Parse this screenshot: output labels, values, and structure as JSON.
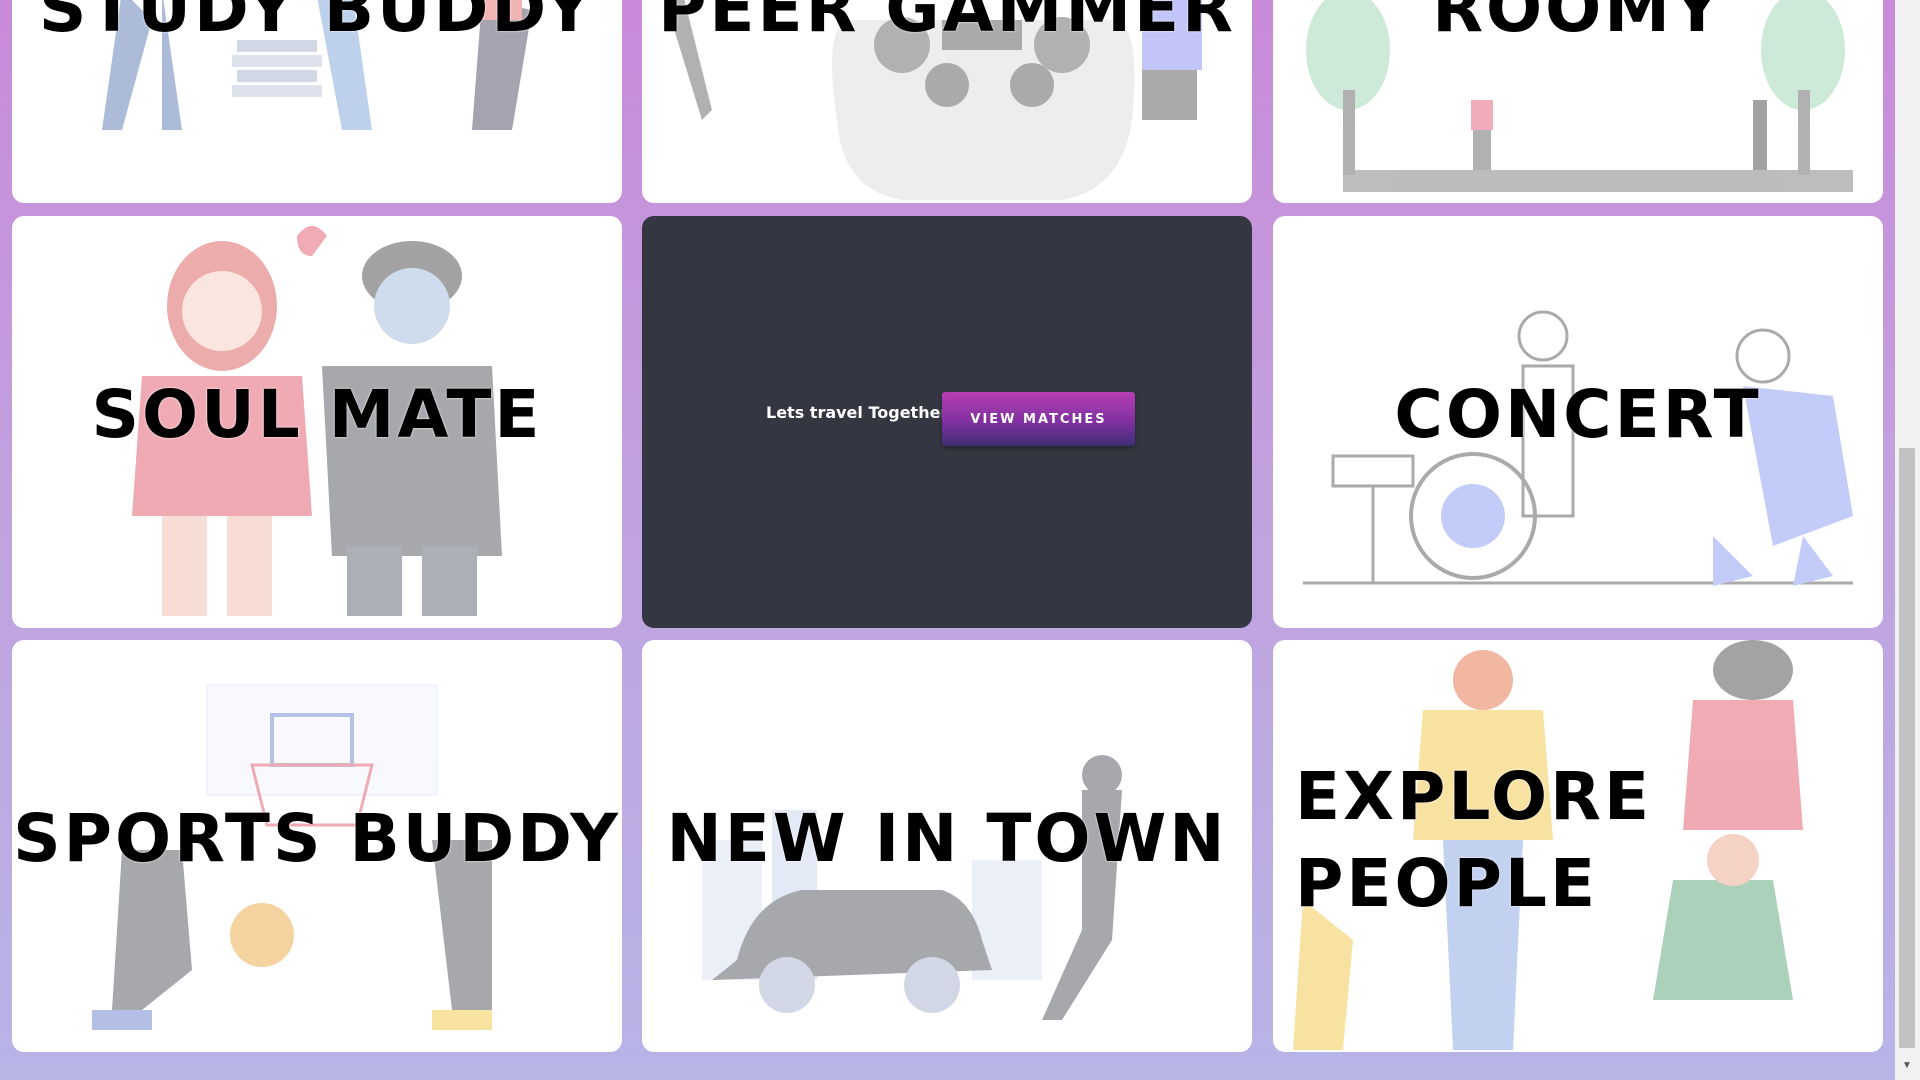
{
  "cards": {
    "study_buddy": {
      "title": "STUDY BUDDY"
    },
    "peer_gammer": {
      "title": "PEER GAMMER"
    },
    "roomy": {
      "title": "ROOMY"
    },
    "soul_mate": {
      "title": "SOUL MATE"
    },
    "travel": {
      "text": "Lets travel Together",
      "button": "VIEW MATCHES"
    },
    "concert": {
      "title": "CONCERT"
    },
    "sports_buddy": {
      "title": "SPORTS BUDDY"
    },
    "new_in_town": {
      "title": "NEW IN TOWN"
    },
    "explore_people": {
      "title_line1": "EXPLORE",
      "title_line2": "PEOPLE"
    }
  },
  "colors": {
    "background_top": "#c98ad9",
    "background_bottom": "#b8b4e6",
    "card": "#ffffff",
    "dark_card": "#343641",
    "button_top": "#b73fb4",
    "button_bottom": "#3c2f73"
  },
  "icons": [
    "scroll-down-arrow-icon"
  ]
}
